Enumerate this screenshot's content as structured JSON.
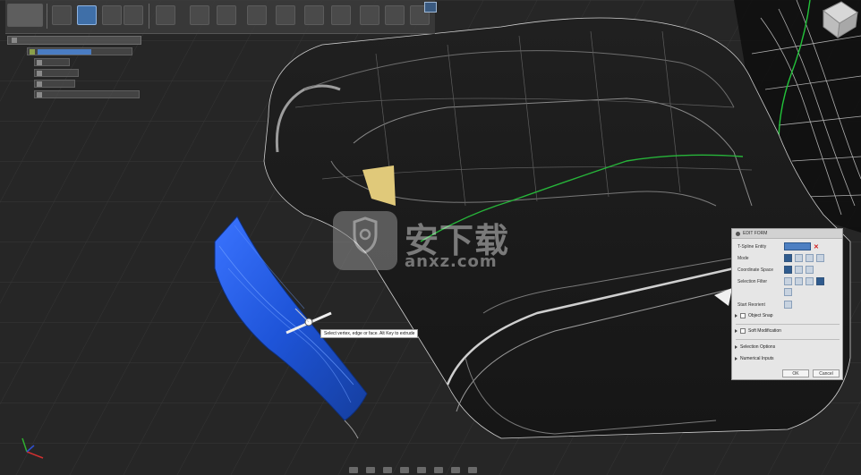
{
  "watermark": {
    "text": "安下载",
    "sub": "anxz.com"
  },
  "tooltip": {
    "text": "Select vertex, edge or face. Alt Key to extrude"
  },
  "edit_form": {
    "title": "EDIT FORM",
    "rows": {
      "tspline_entity": "T-Spline Entity",
      "mode": "Mode",
      "coordinate_space": "Coordinate Space",
      "selection_filter": "Selection Filter",
      "start_reorient": "Start Reorient"
    },
    "sections": {
      "object_snap": "Object Snap",
      "soft_modification": "Soft Modification",
      "selection_options": "Selection Options",
      "numerical_inputs": "Numerical Inputs"
    },
    "ok_label": "OK",
    "cancel_label": "Cancel"
  },
  "colors": {
    "viewport_bg": "#262626",
    "selected_face": "#1d4fd0",
    "green_curve": "#27b53a",
    "accent": "#4d7fc2"
  },
  "icons": [
    "view-cube-icon",
    "screen-icon",
    "shield-icon",
    "close-icon",
    "axis-triad-icon",
    "cursor-icon"
  ]
}
